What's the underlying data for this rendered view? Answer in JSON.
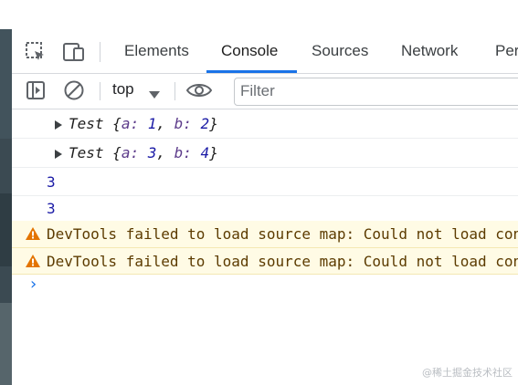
{
  "tabs": {
    "elements": "Elements",
    "console": "Console",
    "sources": "Sources",
    "network": "Network",
    "performance_partial": "Per"
  },
  "toolbar": {
    "context": "top",
    "filter_placeholder": "Filter"
  },
  "console": {
    "logs": [
      {
        "class_name": "Test",
        "open": "{",
        "k1": "a:",
        "v1": "1",
        "k2": "b:",
        "v2": "2",
        "close": "}",
        "sep": ","
      },
      {
        "class_name": "Test",
        "open": "{",
        "k1": "a:",
        "v1": "3",
        "k2": "b:",
        "v2": "4",
        "close": "}",
        "sep": ","
      }
    ],
    "numbers": [
      "3",
      "3"
    ],
    "warnings": [
      "DevTools failed to load source map: Could not load content for",
      "DevTools failed to load source map: Could not load content for"
    ],
    "prompt": "›"
  },
  "watermark": "@稀土掘金技术社区",
  "colors": {
    "accent": "#1a73e8",
    "warning_bg": "#fffbe5",
    "warning_icon": "#e37400"
  }
}
